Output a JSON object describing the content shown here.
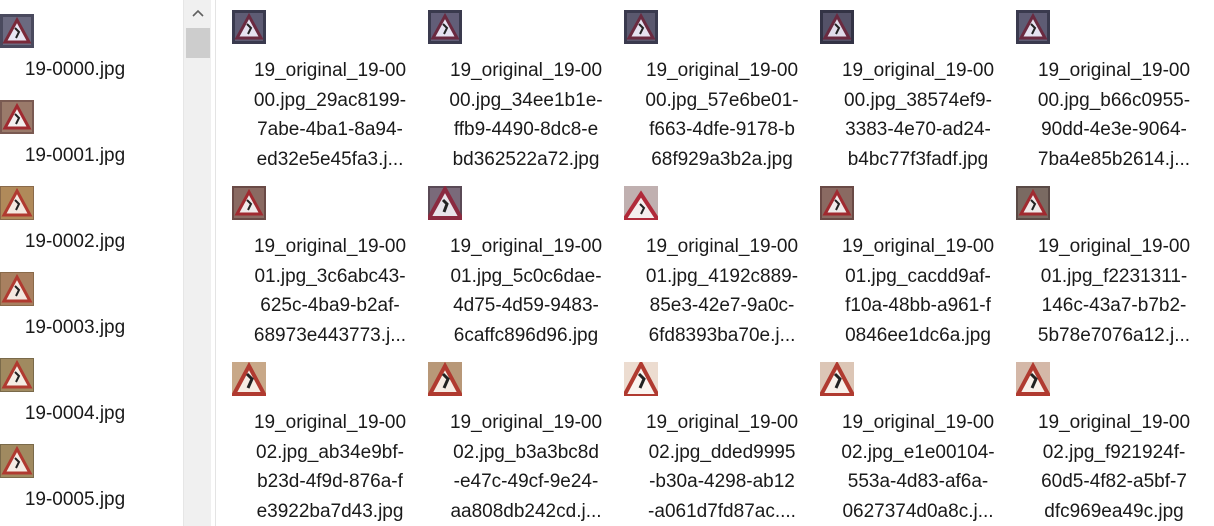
{
  "sidebar": {
    "items": [
      {
        "label": "19-0000.jpg"
      },
      {
        "label": "19-0001.jpg"
      },
      {
        "label": "19-0002.jpg"
      },
      {
        "label": "19-0003.jpg"
      },
      {
        "label": "19-0004.jpg"
      },
      {
        "label": "19-0005.jpg"
      }
    ]
  },
  "grid": {
    "rows": [
      {
        "tiles": [
          {
            "lines": [
              "19_original_19-00",
              "00.jpg_29ac8199-",
              "7abe-4ba1-8a94-",
              "ed32e5e45fa3.j..."
            ]
          },
          {
            "lines": [
              "19_original_19-00",
              "00.jpg_34ee1b1e-",
              "ffb9-4490-8dc8-e",
              "bd362522a72.jpg"
            ]
          },
          {
            "lines": [
              "19_original_19-00",
              "00.jpg_57e6be01-",
              "f663-4dfe-9178-b",
              "68f929a3b2a.jpg"
            ]
          },
          {
            "lines": [
              "19_original_19-00",
              "00.jpg_38574ef9-",
              "3383-4e70-ad24-",
              "b4bc77f3fadf.jpg"
            ]
          },
          {
            "lines": [
              "19_original_19-00",
              "00.jpg_b66c0955-",
              "90dd-4e3e-9064-",
              "7ba4e85b2614.j..."
            ]
          }
        ]
      },
      {
        "tiles": [
          {
            "lines": [
              "19_original_19-00",
              "01.jpg_3c6abc43-",
              "625c-4ba9-b2af-",
              "68973e443773.j..."
            ]
          },
          {
            "lines": [
              "19_original_19-00",
              "01.jpg_5c0c6dae-",
              "4d75-4d59-9483-",
              "6caffc896d96.jpg"
            ]
          },
          {
            "lines": [
              "19_original_19-00",
              "01.jpg_4192c889-",
              "85e3-42e7-9a0c-",
              "6fd8393ba70e.j..."
            ]
          },
          {
            "lines": [
              "19_original_19-00",
              "01.jpg_cacdd9af-",
              "f10a-48bb-a961-f",
              "0846ee1dc6a.jpg"
            ]
          },
          {
            "lines": [
              "19_original_19-00",
              "01.jpg_f2231311-",
              "146c-43a7-b7b2-",
              "5b78e7076a12.j..."
            ]
          }
        ]
      },
      {
        "tiles": [
          {
            "lines": [
              "19_original_19-00",
              "02.jpg_ab34e9bf-",
              "b23d-4f9d-876a-f",
              "e3922ba7d43.jpg"
            ]
          },
          {
            "lines": [
              "19_original_19-00",
              "02.jpg_b3a3bc8d",
              "-e47c-49cf-9e24-",
              "aa808db242cd.j..."
            ]
          },
          {
            "lines": [
              "19_original_19-00",
              "02.jpg_dded9995",
              "-b30a-4298-ab12",
              "-a061d7fd87ac...."
            ]
          },
          {
            "lines": [
              "19_original_19-00",
              "02.jpg_e1e00104-",
              "553a-4d83-af6a-",
              "0627374d0a8c.j..."
            ]
          },
          {
            "lines": [
              "19_original_19-00",
              "02.jpg_f921924f-",
              "60d5-4f82-a5bf-7",
              "dfc969ea49c.jpg"
            ]
          }
        ]
      }
    ]
  }
}
